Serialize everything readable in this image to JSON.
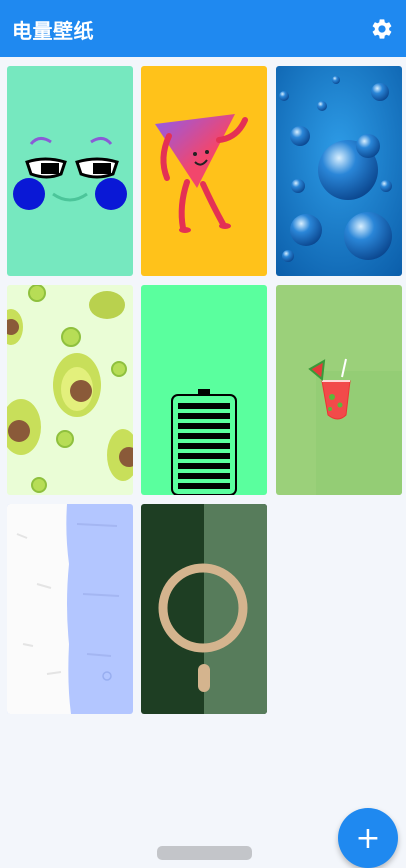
{
  "app_bar": {
    "title": "电量壁纸",
    "settings_icon": "gear-icon",
    "background": "#1f89f0"
  },
  "wallpapers": [
    {
      "id": "faces",
      "name": "wallpaper-cartoon-face"
    },
    {
      "id": "triangle",
      "name": "wallpaper-triangle-character"
    },
    {
      "id": "water",
      "name": "wallpaper-water-drops"
    },
    {
      "id": "avocado",
      "name": "wallpaper-avocado-pattern"
    },
    {
      "id": "battery",
      "name": "wallpaper-battery-bars"
    },
    {
      "id": "drink",
      "name": "wallpaper-watermelon-drink"
    },
    {
      "id": "paint",
      "name": "wallpaper-white-blue-paint"
    },
    {
      "id": "ring",
      "name": "wallpaper-magsafe-ring"
    }
  ],
  "fab": {
    "label": "+",
    "icon": "add-icon"
  }
}
